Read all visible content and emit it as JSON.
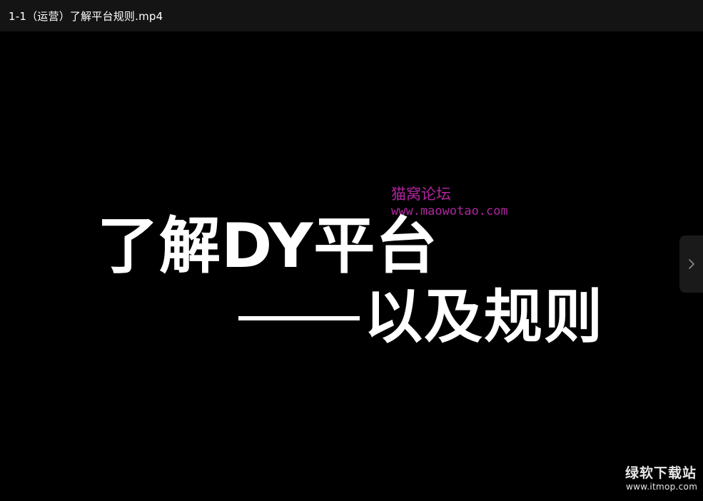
{
  "window": {
    "title": "1-1（运营）了解平台规则.mp4"
  },
  "video": {
    "watermark_site": "猫窝论坛",
    "watermark_url": "www.maowotao.com",
    "headline_line1": "了解DY平台",
    "headline_line2": "以及规则",
    "corner_brand": "绿软下载站",
    "corner_url": "www.itmop.com"
  },
  "controls": {
    "next_icon": "chevron-right-icon"
  },
  "colors": {
    "background": "#000000",
    "titlebar": "#141414",
    "watermark": "#b0269f",
    "headline": "#ffffff"
  }
}
